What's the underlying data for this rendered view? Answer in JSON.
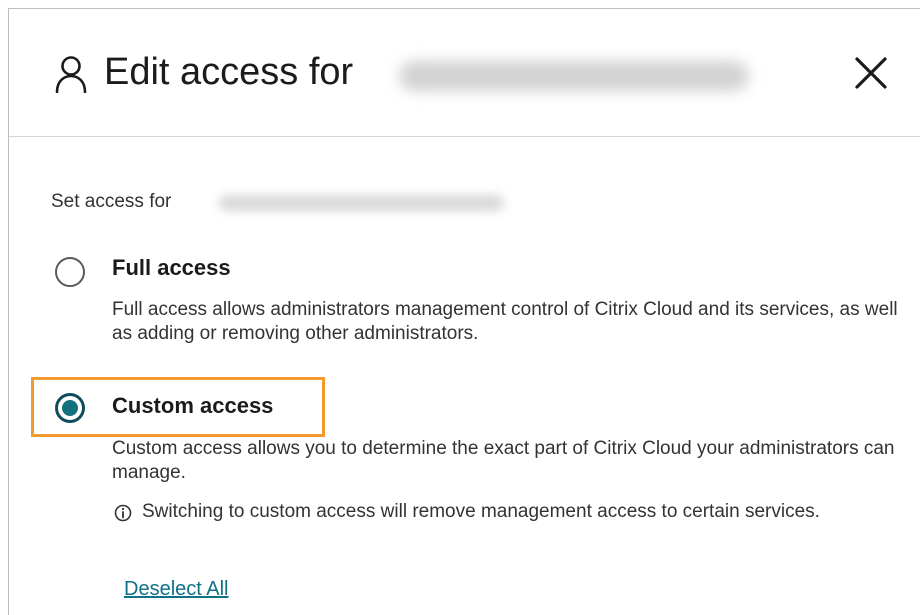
{
  "dialog": {
    "title": "Edit access for",
    "title_icon": "user-icon",
    "close_icon": "close-icon"
  },
  "access": {
    "set_access_label": "Set access for",
    "options": [
      {
        "label": "Full access",
        "description": "Full access allows administrators management control of Citrix Cloud and its services, as well as adding or removing other administrators.",
        "selected": false
      },
      {
        "label": "Custom access",
        "description": "Custom access allows you to determine the exact part of Citrix Cloud your administrators can manage.",
        "selected": true
      }
    ],
    "info_icon": "info-icon",
    "info_note": "Switching to custom access will remove management access to certain services.",
    "deselect_all_link": "Deselect All"
  },
  "colors": {
    "highlight": "#f29a2e",
    "radio_selected": "#12707f",
    "link": "#0e7185"
  }
}
